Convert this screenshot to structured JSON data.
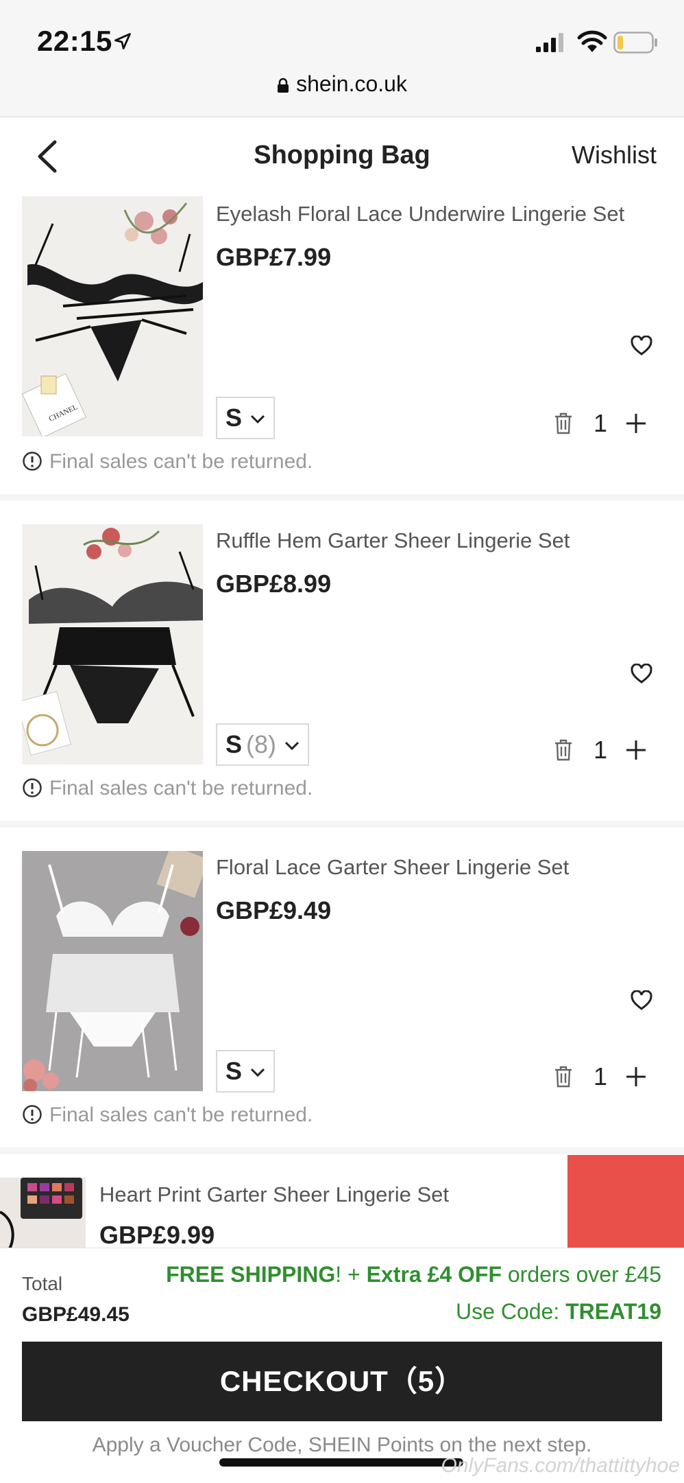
{
  "status_bar": {
    "time": "22:15",
    "url": "shein.co.uk"
  },
  "header": {
    "title": "Shopping Bag",
    "wishlist_label": "Wishlist"
  },
  "cart_items": [
    {
      "name": "Eyelash Floral Lace Underwire Lingerie Set",
      "price": "GBP£7.99",
      "size": "S",
      "size_stock": "",
      "quantity": "1",
      "notice": "Final sales can't be returned.",
      "image_caption": "CHANEL"
    },
    {
      "name": "Ruffle Hem Garter Sheer Lingerie Set",
      "price": "GBP£8.99",
      "size": "S",
      "size_stock": "(8)",
      "quantity": "1",
      "notice": "Final sales can't be returned."
    },
    {
      "name": "Floral Lace Garter Sheer Lingerie Set",
      "price": "GBP£9.49",
      "size": "S",
      "size_stock": "",
      "quantity": "1",
      "notice": "Final sales can't be returned."
    },
    {
      "name": "Heart Print Garter Sheer Lingerie Set",
      "price": "GBP£9.99"
    }
  ],
  "summary": {
    "total_label": "Total",
    "total_value": "GBP£49.45",
    "promo_free": "FREE SHIPPING",
    "promo_mid": "! + ",
    "promo_extra": "Extra £4 OFF",
    "promo_tail": " orders over £45",
    "code_label": "Use Code: ",
    "code_value": "TREAT19",
    "checkout_label": "CHECKOUT（5）",
    "voucher_note": "Apply a Voucher Code, SHEIN Points on the next step."
  },
  "watermark": "OnlyFans.com/thattittyhoe",
  "colors": {
    "promo_green": "#2f8f2f",
    "checkout_bg": "#222222",
    "accent_red": "#e9504a"
  }
}
